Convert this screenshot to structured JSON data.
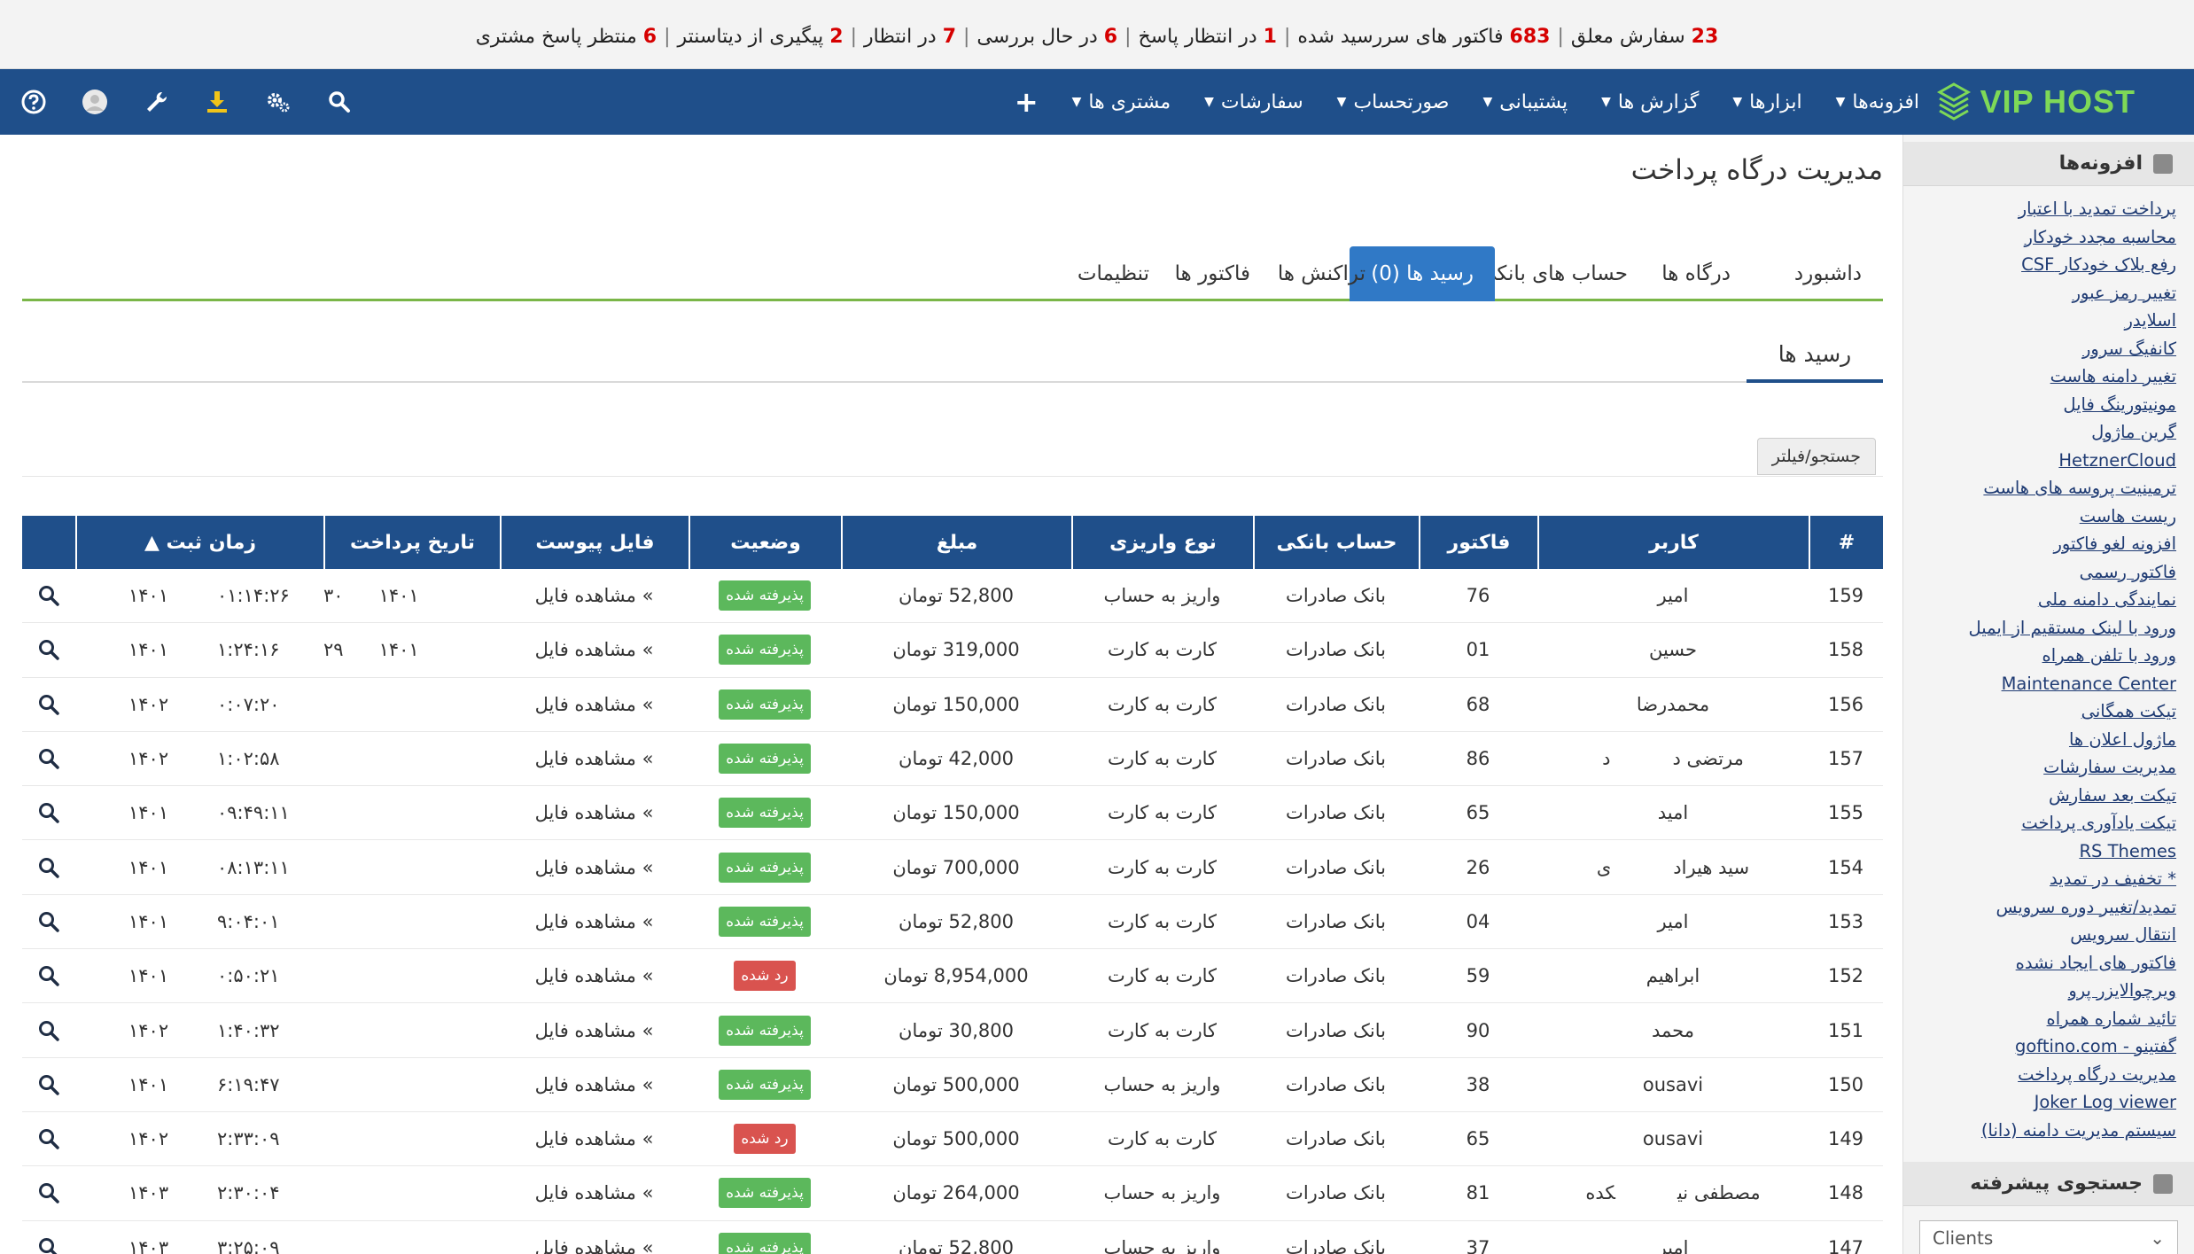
{
  "notification_bar": {
    "items": [
      {
        "count": "23",
        "label": "سفارش معلق"
      },
      {
        "count": "683",
        "label": "فاکتور های سررسید شده"
      },
      {
        "count": "1",
        "label": "در انتظار پاسخ"
      },
      {
        "count": "6",
        "label": "در حال بررسی"
      },
      {
        "count": "7",
        "label": "در انتظار"
      },
      {
        "count": "2",
        "label": "پیگیری از دیتاسنتر"
      },
      {
        "count": "6",
        "label": "منتظر پاسخ مشتری"
      }
    ]
  },
  "navbar": {
    "logo_text": "VIP HOST",
    "menu": [
      "مشتری ها",
      "سفارشات",
      "صورتحساب",
      "پشتیبانی",
      "گزارش ها",
      "ابزارها",
      "افزونه‌ها"
    ],
    "plus_label": "+",
    "icons": [
      "search-icon",
      "settings-icon",
      "download-icon",
      "wrench-icon",
      "user-avatar-icon",
      "help-icon"
    ]
  },
  "page": {
    "title": "مدیریت درگاه پرداخت",
    "tabs": [
      "داشبورد",
      "درگاه ها",
      "حساب های بانکی",
      "رسید ها (0)",
      "تراکنش ها",
      "فاکتور ها",
      "تنظیمات"
    ],
    "active_tab": "رسید ها (0)",
    "subtab": "رسید ها",
    "filter_button": "جستجو/فیلتر"
  },
  "table": {
    "headers": [
      "#",
      "کاربر",
      "فاکتور",
      "حساب بانکی",
      "نوع واریزی",
      "مبلغ",
      "وضعیت",
      "فایل پیوست",
      "تاریخ پرداخت",
      "زمان ثبت ▲",
      ""
    ],
    "view_file_label": "» مشاهده فایل",
    "rows": [
      {
        "id": "159",
        "user": "امیر",
        "user_extra": "",
        "invoice": "76",
        "bank": "بانک صادرات",
        "type": "واریز به حساب",
        "amount": "52,800 تومان",
        "status": "پذیرفته شده",
        "status_class": "ok",
        "pay_date": "۱۴۰۱",
        "pay_date_extra": "۳۰",
        "reg_year": "۱۴۰۱",
        "reg_time": "۰۱:۱۴:۲۶"
      },
      {
        "id": "158",
        "user": "حسین",
        "user_extra": "",
        "invoice": "01",
        "bank": "بانک صادرات",
        "type": "کارت به کارت",
        "amount": "319,000 تومان",
        "status": "پذیرفته شده",
        "status_class": "ok",
        "pay_date": "۱۴۰۱",
        "pay_date_extra": "۲۹",
        "reg_year": "۱۴۰۱",
        "reg_time": "۱:۲۴:۱۶"
      },
      {
        "id": "156",
        "user": "محمدرضا",
        "user_extra": "",
        "invoice": "68",
        "bank": "بانک صادرات",
        "type": "کارت به کارت",
        "amount": "150,000 تومان",
        "status": "پذیرفته شده",
        "status_class": "ok",
        "pay_date": "",
        "pay_date_extra": "",
        "reg_year": "۱۴۰۲",
        "reg_time": "۰:۰۷:۲۰"
      },
      {
        "id": "157",
        "user": "مرتضی د",
        "user_extra": "د",
        "invoice": "86",
        "bank": "بانک صادرات",
        "type": "کارت به کارت",
        "amount": "42,000 تومان",
        "status": "پذیرفته شده",
        "status_class": "ok",
        "pay_date": "",
        "pay_date_extra": "",
        "reg_year": "۱۴۰۲",
        "reg_time": "۱:۰۲:۵۸"
      },
      {
        "id": "155",
        "user": "امید",
        "user_extra": "",
        "invoice": "65",
        "bank": "بانک صادرات",
        "type": "کارت به کارت",
        "amount": "150,000 تومان",
        "status": "پذیرفته شده",
        "status_class": "ok",
        "pay_date": "",
        "pay_date_extra": "",
        "reg_year": "۱۴۰۱",
        "reg_time": "۰۹:۴۹:۱۱"
      },
      {
        "id": "154",
        "user": "سید هیراد",
        "user_extra": "ی",
        "invoice": "26",
        "bank": "بانک صادرات",
        "type": "کارت به کارت",
        "amount": "700,000 تومان",
        "status": "پذیرفته شده",
        "status_class": "ok",
        "pay_date": "",
        "pay_date_extra": "",
        "reg_year": "۱۴۰۱",
        "reg_time": "۰۸:۱۳:۱۱"
      },
      {
        "id": "153",
        "user": "امیر",
        "user_extra": "",
        "invoice": "04",
        "bank": "بانک صادرات",
        "type": "کارت به کارت",
        "amount": "52,800 تومان",
        "status": "پذیرفته شده",
        "status_class": "ok",
        "pay_date": "",
        "pay_date_extra": "",
        "reg_year": "۱۴۰۱",
        "reg_time": "۹:۰۴:۰۱"
      },
      {
        "id": "152",
        "user": "ابراهیم",
        "user_extra": "",
        "invoice": "59",
        "bank": "بانک صادرات",
        "type": "کارت به کارت",
        "amount": "8,954,000 تومان",
        "status": "رد شده",
        "status_class": "rej",
        "pay_date": "",
        "pay_date_extra": "",
        "reg_year": "۱۴۰۱",
        "reg_time": "۰:۵۰:۲۱"
      },
      {
        "id": "151",
        "user": "محمد",
        "user_extra": "",
        "invoice": "90",
        "bank": "بانک صادرات",
        "type": "کارت به کارت",
        "amount": "30,800 تومان",
        "status": "پذیرفته شده",
        "status_class": "ok",
        "pay_date": "",
        "pay_date_extra": "",
        "reg_year": "۱۴۰۲",
        "reg_time": "۱:۴۰:۳۲"
      },
      {
        "id": "150",
        "user": "ousavi",
        "user_extra": "",
        "invoice": "38",
        "bank": "بانک صادرات",
        "type": "واریز به حساب",
        "amount": "500,000 تومان",
        "status": "پذیرفته شده",
        "status_class": "ok",
        "pay_date": "",
        "pay_date_extra": "",
        "reg_year": "۱۴۰۱",
        "reg_time": "۶:۱۹:۴۷"
      },
      {
        "id": "149",
        "user": "ousavi",
        "user_extra": "",
        "invoice": "65",
        "bank": "بانک صادرات",
        "type": "کارت به کارت",
        "amount": "500,000 تومان",
        "status": "رد شده",
        "status_class": "rej",
        "pay_date": "",
        "pay_date_extra": "",
        "reg_year": "۱۴۰۲",
        "reg_time": "۲:۳۳:۰۹"
      },
      {
        "id": "148",
        "user": "مصطفی نی",
        "user_extra": "کده",
        "invoice": "81",
        "bank": "بانک صادرات",
        "type": "واریز به حساب",
        "amount": "264,000 تومان",
        "status": "پذیرفته شده",
        "status_class": "ok",
        "pay_date": "",
        "pay_date_extra": "",
        "reg_year": "۱۴۰۳",
        "reg_time": "۲:۳۰:۰۴"
      },
      {
        "id": "147",
        "user": "امیر",
        "user_extra": "",
        "invoice": "37",
        "bank": "بانک صادرات",
        "type": "واریز به حساب",
        "amount": "52,800 تومان",
        "status": "پذیرفته شده",
        "status_class": "ok",
        "pay_date": "",
        "pay_date_extra": "",
        "reg_year": "۱۴۰۳",
        "reg_time": "۳:۲۵:۰۹"
      }
    ]
  },
  "sidebar": {
    "addons_title": "افزونه‌ها",
    "links": [
      "پرداخت تمدید با اعتبار",
      "محاسبه مجدد خودکار",
      "رفع بلاک خودکار CSF",
      "تغییر رمز عبور",
      "اسلایدر",
      "کانفیگ سرور",
      "تغییر دامنه هاست",
      "مونیتورینگ فایل",
      "گرین ماژول",
      "HetznerCloud",
      "ترمینیت پروسه های هاست",
      "ریست هاست",
      "افزونه لغو فاکتور",
      "فاکتور رسمی",
      "نمایندگی دامنه ملی",
      "ورود با لینک مستقیم از ایمیل",
      "ورود با تلفن همراه",
      "Maintenance Center",
      "تیکت همگانی",
      "ماژول اعلان ها",
      "مدیریت سفارشات",
      "تیکت بعد سفارش",
      "تیکت یادآوری پرداخت",
      "RS Themes",
      "* تخفیف در تمدید",
      "تمدید/تغییر دوره سرویس",
      "انتقال سرویس",
      "فاکتور های ایجاد نشده",
      "ویرچوالایزر پرو",
      "تائید شماره همراه",
      "گفتینو - goftino.com",
      "مدیریت درگاه پرداخت",
      "Joker Log viewer",
      "سیستم مدیریت دامنه (دانا)"
    ],
    "advanced_search_title": "جستجوی پیشرفته",
    "search_select_value": "Clients"
  }
}
